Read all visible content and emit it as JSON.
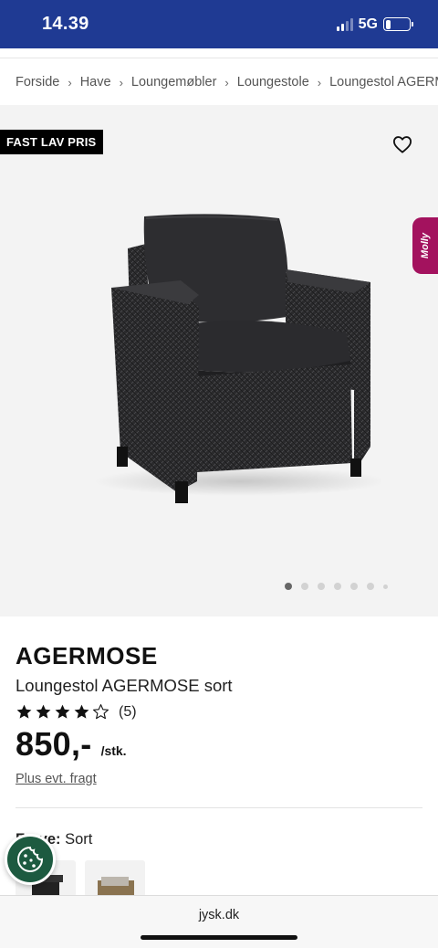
{
  "status": {
    "time": "14.39",
    "network": "5G",
    "battery_level": 0.2
  },
  "breadcrumb": [
    "Forside",
    "Have",
    "Loungemøbler",
    "Loungestole",
    "Loungestol AGERMOSE"
  ],
  "gallery": {
    "badge": "FAST LAV PRIS",
    "favorite_icon": "heart-outline-icon",
    "chat_tab": "Molly",
    "image_count": 7,
    "active_image": 1
  },
  "product": {
    "brand": "AGERMOSE",
    "name": "Loungestol AGERMOSE sort",
    "rating": 4,
    "rating_max": 5,
    "review_count": "(5)",
    "price": "850,-",
    "price_unit": "/stk.",
    "freight_note": "Plus evt. fragt",
    "color_label": "Farve:",
    "color_value": "Sort"
  },
  "browser": {
    "url": "jysk.dk"
  },
  "colors": {
    "status_bar": "#1f3a93",
    "molly_tab": "#a3125e",
    "cookie_button": "#1d5a40"
  }
}
